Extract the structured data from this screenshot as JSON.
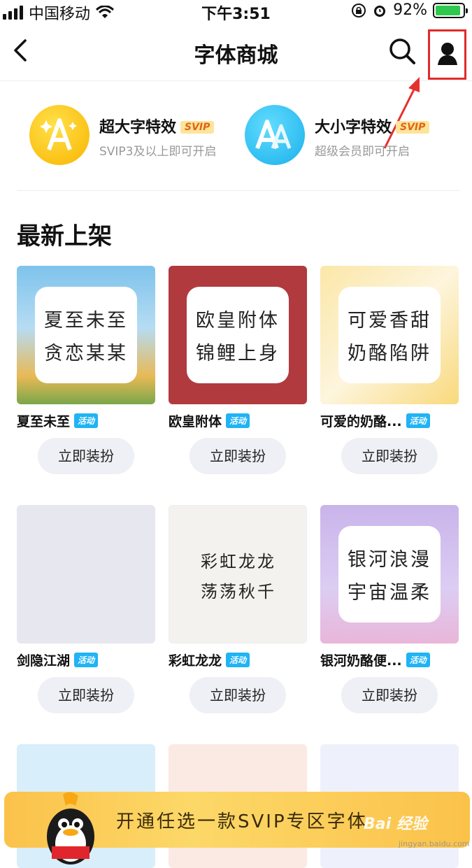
{
  "status": {
    "carrier": "中国移动",
    "time": "下午3:51",
    "battery": "92%",
    "battery_level": 0.92
  },
  "nav": {
    "title": "字体商城",
    "back_icon": "back-icon",
    "search_icon": "search-icon",
    "profile_icon": "profile-icon"
  },
  "features": [
    {
      "name": "超大字特效",
      "badge": "SVIP",
      "sub": "SVIP3及以上即可开启",
      "icon": "A",
      "color": "#fbc52a"
    },
    {
      "name": "大小字特效",
      "badge": "SVIP",
      "sub": "超级会员即可开启",
      "icon": "AA",
      "color": "#35c5f2"
    }
  ],
  "section_title": "最新上架",
  "cards": [
    {
      "name": "夏至未至",
      "tag": "活动",
      "button": "立即装扮",
      "line1": "夏至未至",
      "line2": "贪恋某某"
    },
    {
      "name": "欧皇附体",
      "tag": "活动",
      "button": "立即装扮",
      "line1": "欧皇附体",
      "line2": "锦鲤上身"
    },
    {
      "name": "可爱的奶酪...",
      "tag": "活动",
      "button": "立即装扮",
      "line1": "可爱香甜",
      "line2": "奶酪陷阱"
    },
    {
      "name": "剑隐江湖",
      "tag": "活动",
      "button": "立即装扮",
      "line1": "",
      "line2": ""
    },
    {
      "name": "彩虹龙龙",
      "tag": "活动",
      "button": "立即装扮",
      "line1": "彩虹龙龙",
      "line2": "荡荡秋千"
    },
    {
      "name": "银河奶酪便...",
      "tag": "活动",
      "button": "立即装扮",
      "line1": "银河浪漫",
      "line2": "宇宙温柔"
    }
  ],
  "banner": {
    "text": "开通任选一款SVIP专区字体"
  },
  "watermark": {
    "text": "Bai 经验",
    "sub": "jingyan.baidu.com"
  }
}
